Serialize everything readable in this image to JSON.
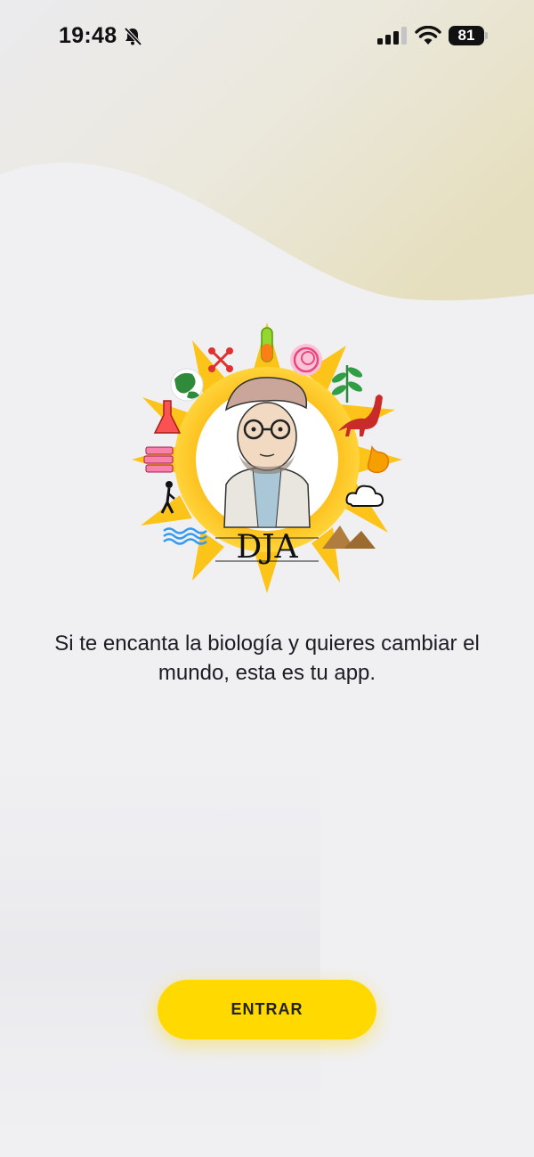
{
  "status_bar": {
    "time": "19:48",
    "battery_level": "81",
    "icons": [
      "bell-slash-icon",
      "cellular-signal-icon",
      "wifi-icon",
      "battery-icon"
    ]
  },
  "logo": {
    "text": "DJA",
    "sun_color": "#fcc419",
    "icons": [
      "globe-icon",
      "molecule-icon",
      "test-tube-icon",
      "dna-scribble-icon",
      "plant-icon",
      "flask-icon",
      "dinosaur-icon",
      "books-icon",
      "stomach-icon",
      "walking-person-icon",
      "cloud-icon",
      "water-waves-icon",
      "mountains-icon"
    ]
  },
  "tagline": "Si te encanta la biología y quieres cambiar el mundo, esta es tu app.",
  "enter_button": {
    "label": "ENTRAR",
    "color": "#ffd900"
  }
}
